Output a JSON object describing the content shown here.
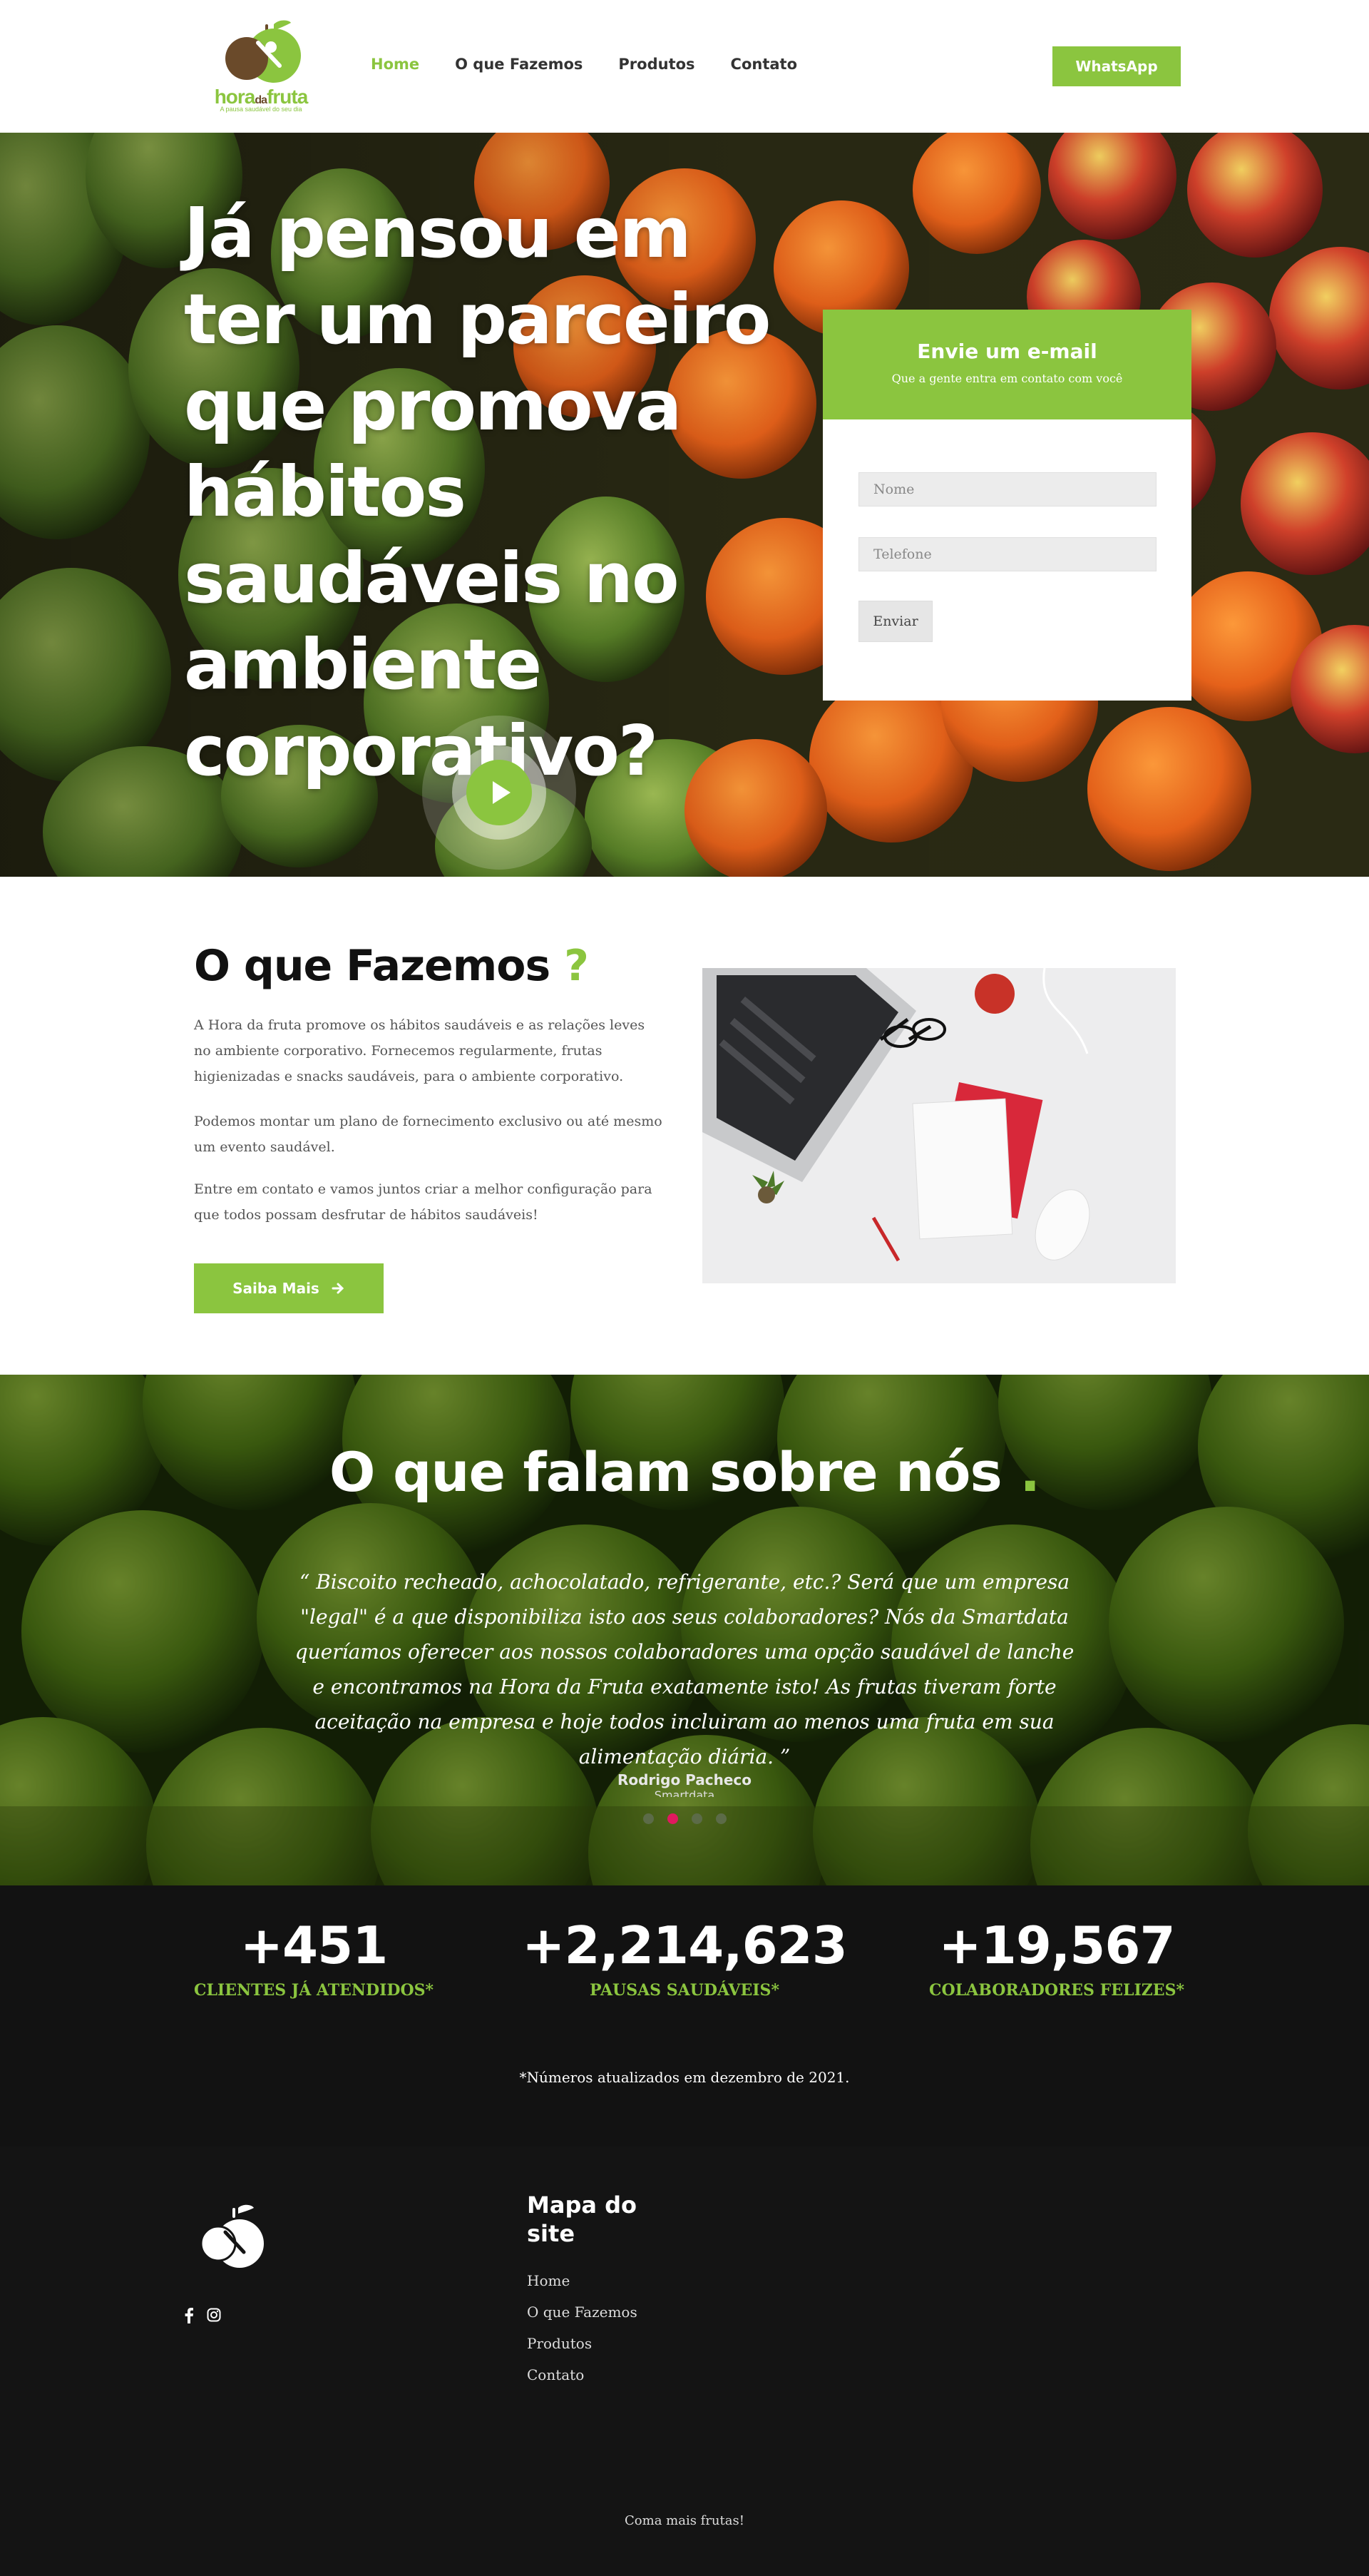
{
  "brand": {
    "logo_text_main": "hora",
    "logo_text_da": "da",
    "logo_text_end": "fruta",
    "tagline": "A pausa saudável do seu dia",
    "accent_color": "#8bc53f",
    "dark_color": "#121212"
  },
  "nav": {
    "items": [
      {
        "label": "Home",
        "active": true
      },
      {
        "label": "O que Fazemos",
        "active": false
      },
      {
        "label": "Produtos",
        "active": false
      },
      {
        "label": "Contato",
        "active": false
      }
    ],
    "whatsapp_label": "WhatsApp"
  },
  "hero": {
    "title": "Já pensou em ter um parceiro que promova hábitos saudáveis no ambiente corporativo?",
    "play_icon": "play-icon",
    "form": {
      "title": "Envie um e-mail",
      "subtitle": "Que a gente entra em contato com você",
      "name_placeholder": "Nome",
      "phone_placeholder": "Telefone",
      "submit_label": "Enviar"
    }
  },
  "what_we_do": {
    "title": "O que Fazemos",
    "title_mark": "?",
    "paragraphs": [
      "A Hora da fruta promove os hábitos saudáveis e as relações leves no ambiente corporativo. Fornecemos regularmente, frutas higienizadas e snacks saudáveis, para o ambiente corporativo.",
      "Podemos montar um plano de fornecimento exclusivo ou até mesmo um evento saudável.",
      "Entre em contato e vamos juntos criar a melhor configuração para que todos possam desfrutar de hábitos saudáveis!"
    ],
    "button_label": "Saiba Mais",
    "button_icon": "arrow-right-icon"
  },
  "testimonials": {
    "title": "O que falam sobre nós",
    "title_mark": ".",
    "quote": "“ Biscoito recheado, achocolatado, refrigerante, etc.? Será que um empresa \"legal\" é a que disponibiliza isto aos seus colaboradores? Nós da Smartdata queríamos oferecer aos nossos colaboradores uma opção saudável de lanche e encontramos na Hora da Fruta exatamente isto! As frutas tiveram forte aceitação na empresa e hoje todos incluiram ao menos uma fruta em sua alimentação diária. ”",
    "author": "Rodrigo Pacheco",
    "role": "Smartdata",
    "dots": 4,
    "active_dot": 1
  },
  "stats": {
    "items": [
      {
        "number": "+451",
        "label": "CLIENTES JÁ ATENDIDOS*"
      },
      {
        "number": "+2,214,623",
        "label": "PAUSAS SAUDÁVEIS*"
      },
      {
        "number": "+19,567",
        "label": "COLABORADORES FELIZES*"
      }
    ],
    "note": "*Números atualizados em dezembro de 2021."
  },
  "footer": {
    "sitemap_title": "Mapa do site",
    "links": [
      "Home",
      "O que Fazemos",
      "Produtos",
      "Contato"
    ],
    "social_icons": [
      "facebook-icon",
      "instagram-icon"
    ],
    "copyright": "Coma mais frutas!"
  }
}
